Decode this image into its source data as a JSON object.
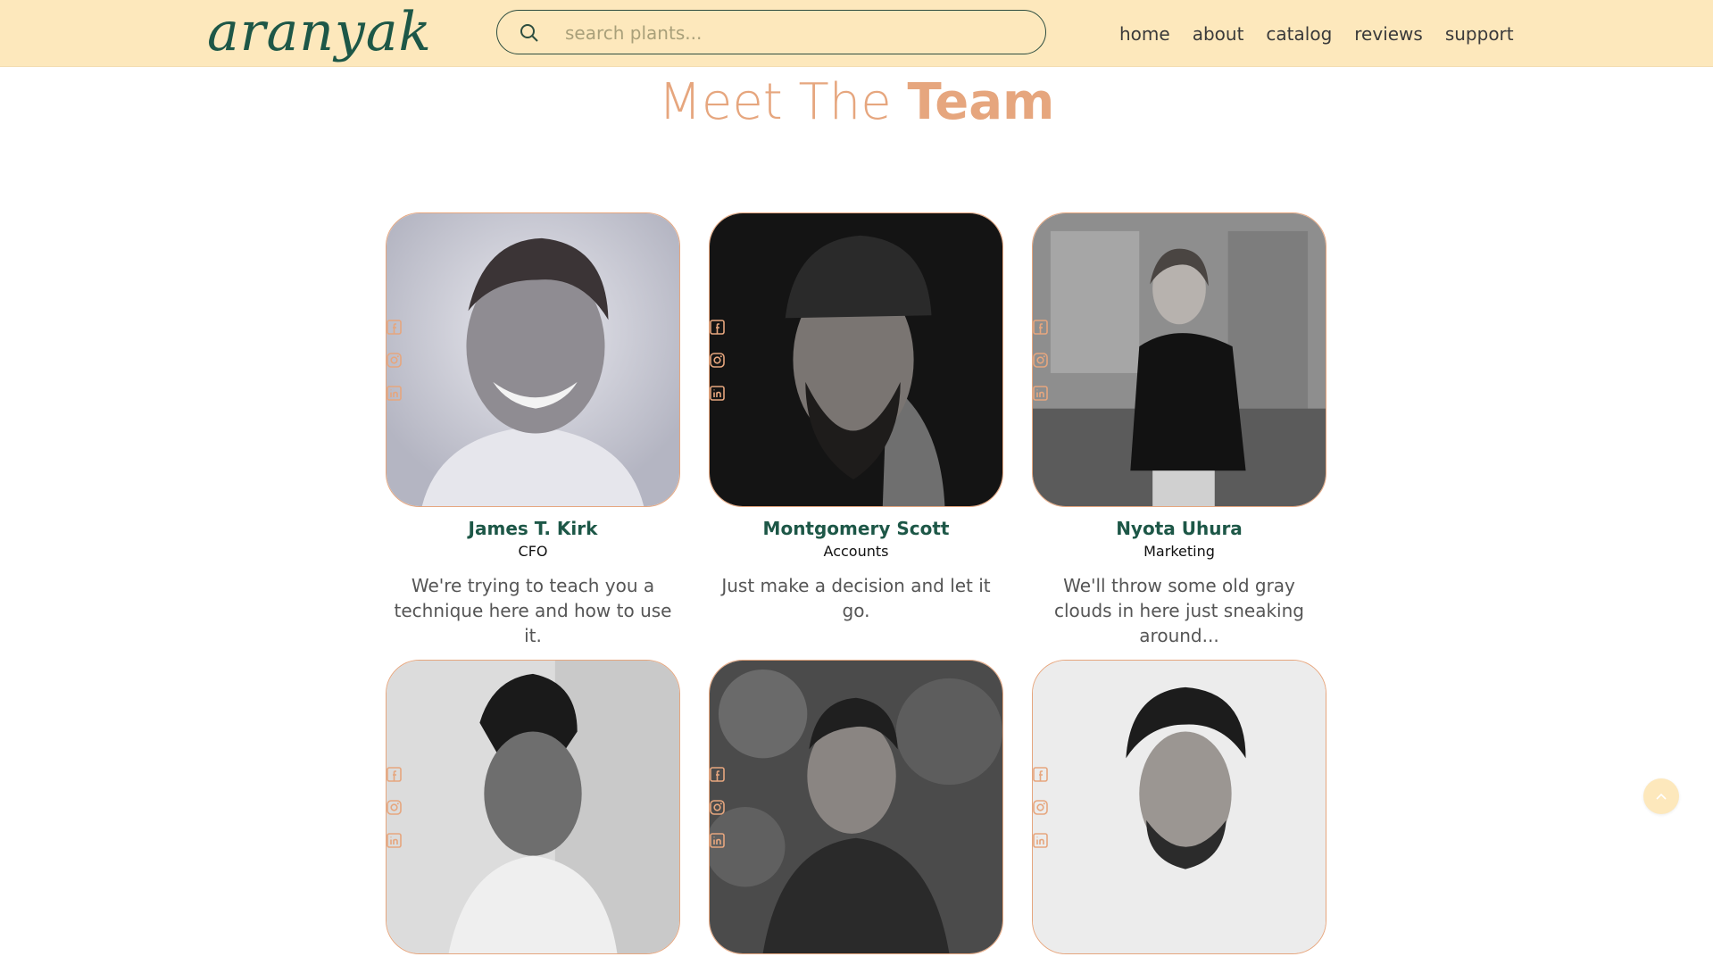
{
  "nav": {
    "logo": "aranyak",
    "search_placeholder": "search plants...",
    "links": [
      "home",
      "about",
      "catalog",
      "reviews",
      "support"
    ]
  },
  "section": {
    "title_light": "Meet The ",
    "title_bold": "Team"
  },
  "team": [
    {
      "name": "James T. Kirk",
      "role": "CFO",
      "quote": "We're trying to teach you a technique here and how to use it."
    },
    {
      "name": "Montgomery Scott",
      "role": "Accounts",
      "quote": "Just make a decision and let it go."
    },
    {
      "name": "Nyota Uhura",
      "role": "Marketing",
      "quote": "We'll throw some old gray clouds in here just sneaking around..."
    },
    {
      "name": "",
      "role": "",
      "quote": ""
    },
    {
      "name": "",
      "role": "",
      "quote": ""
    },
    {
      "name": "",
      "role": "",
      "quote": ""
    }
  ],
  "icons": {
    "search": "search-icon",
    "social": [
      "facebook-icon",
      "instagram-icon",
      "linkedin-icon"
    ],
    "scroll_top": "chevron-up-icon"
  },
  "colors": {
    "navbar_bg": "#fde8bc",
    "brand_green": "#1d5747",
    "accent_peach": "#e6a67e"
  }
}
